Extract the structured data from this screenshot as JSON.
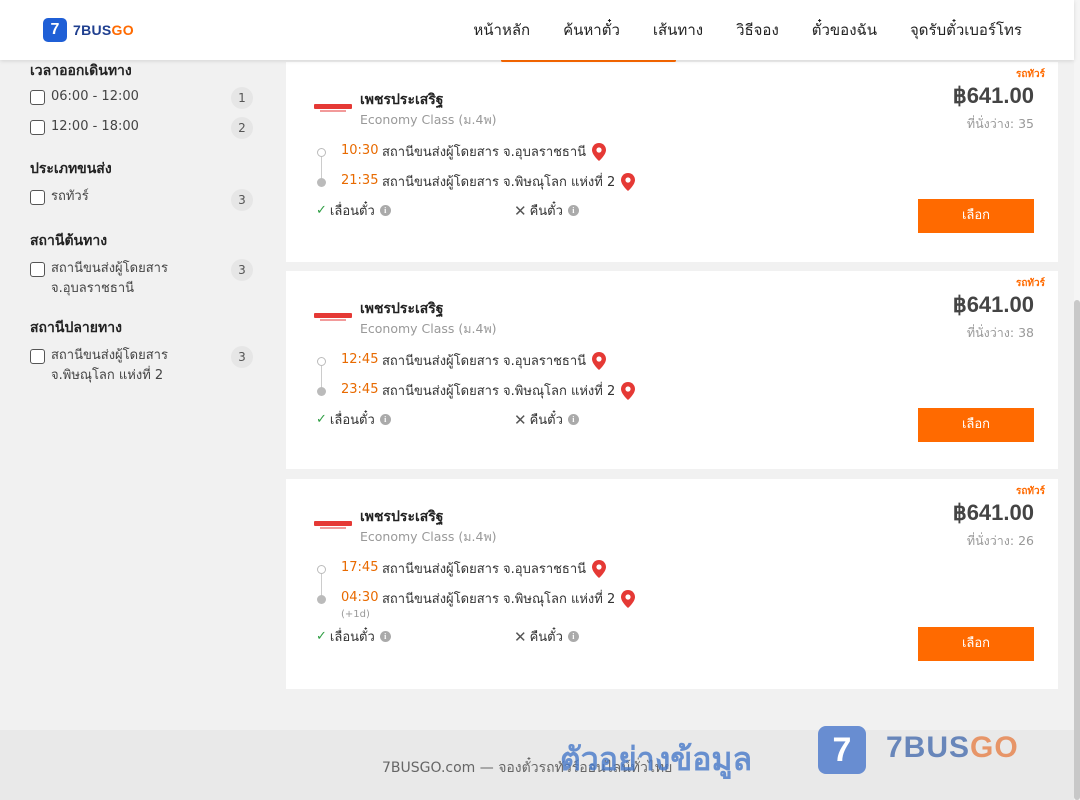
{
  "header": {
    "logo": {
      "badge": "7",
      "text": "7BUS",
      "text_accent": "GO"
    },
    "nav": [
      "หน้าหลัก",
      "ค้นหาตั๋ว",
      "เส้นทาง",
      "วิธีจอง",
      "ตั๋วของฉัน",
      "จุดรับตั๋วเบอร์โทร"
    ]
  },
  "filters": {
    "departure_time": {
      "title": "เวลาออกเดินทาง",
      "options": [
        {
          "label": "06:00 - 12:00",
          "count": "1"
        },
        {
          "label": "12:00 - 18:00",
          "count": "2"
        }
      ]
    },
    "transport_type": {
      "title": "ประเภทขนส่ง",
      "options": [
        {
          "label": "รถทัวร์",
          "count": "3"
        }
      ]
    },
    "origin": {
      "title": "สถานีต้นทาง",
      "options": [
        {
          "label_line1": "สถานีขนส่งผู้โดยสาร",
          "label_line2": "จ.อุบลราชธานี",
          "count": "3"
        }
      ]
    },
    "destination": {
      "title": "สถานีปลายทาง",
      "options": [
        {
          "label_line1": "สถานีขนส่งผู้โดยสาร",
          "label_line2": "จ.พิษณุโลก แห่งที่ 2",
          "count": "3"
        }
      ]
    }
  },
  "results": [
    {
      "tag": "รถทัวร์",
      "operator": "เพชรประเสริฐ",
      "class": "Economy Class (ม.4พ)",
      "price": "฿641.00",
      "seats": "ที่นั่งว่าง: 35",
      "depart_time": "10:30",
      "depart_station": "สถานีขนส่งผู้โดยสาร จ.อุบลราชธานี",
      "arrive_time": "21:35",
      "arrive_station": "สถานีขนส่งผู้โดยสาร จ.พิษณุโลก แห่งที่ 2",
      "next_day": "",
      "refund": "เลื่อนตั๋ว",
      "cancel": "คืนตั๋ว",
      "button": "เลือก"
    },
    {
      "tag": "รถทัวร์",
      "operator": "เพชรประเสริฐ",
      "class": "Economy Class (ม.4พ)",
      "price": "฿641.00",
      "seats": "ที่นั่งว่าง: 38",
      "depart_time": "12:45",
      "depart_station": "สถานีขนส่งผู้โดยสาร จ.อุบลราชธานี",
      "arrive_time": "23:45",
      "arrive_station": "สถานีขนส่งผู้โดยสาร จ.พิษณุโลก แห่งที่ 2",
      "next_day": "",
      "refund": "เลื่อนตั๋ว",
      "cancel": "คืนตั๋ว",
      "button": "เลือก"
    },
    {
      "tag": "รถทัวร์",
      "operator": "เพชรประเสริฐ",
      "class": "Economy Class (ม.4พ)",
      "price": "฿641.00",
      "seats": "ที่นั่งว่าง: 26",
      "depart_time": "17:45",
      "depart_station": "สถานีขนส่งผู้โดยสาร จ.อุบลราชธานี",
      "arrive_time": "04:30",
      "arrive_station": "สถานีขนส่งผู้โดยสาร จ.พิษณุโลก แห่งที่ 2",
      "next_day": "(+1d)",
      "refund": "เลื่อนตั๋ว",
      "cancel": "คืนตั๋ว",
      "button": "เลือก"
    }
  ],
  "footer": {
    "text": "7BUSGO.com — จองตั๋วรถทัวร์ออนไลน์ทั่วไทย",
    "watermark": "ตัวอย่างข้อมูล",
    "wm_badge": "7",
    "wm_brand": "7BUS",
    "wm_brand_accent": "GO"
  },
  "colors": {
    "accent": "#ff6a00",
    "brand_blue": "#1f5fd6",
    "pin_red": "#e53935",
    "check_green": "#2f9e44"
  }
}
